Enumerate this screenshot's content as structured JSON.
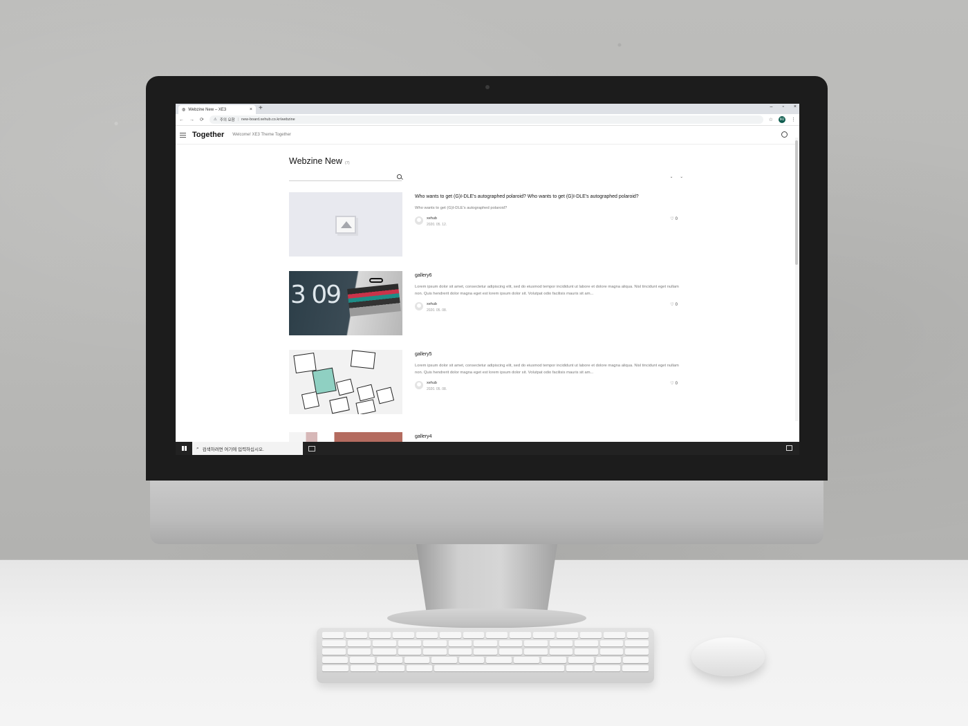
{
  "browser": {
    "tab_title": "Webzine New – XE3",
    "tab_close": "×",
    "new_tab": "+",
    "window_controls": [
      "–",
      "▫",
      "×"
    ],
    "nav_buttons": [
      "←",
      "→",
      "⟳"
    ],
    "security_label": "주의 요함",
    "url": "new-board.xehub.co.kr/webzine",
    "profile_initials": "MJ"
  },
  "site": {
    "logo": "Together",
    "tagline": "Welcome! XE3 Theme Together"
  },
  "board": {
    "title": "Webzine New",
    "count": "(7)",
    "search_placeholder": "",
    "sort_a": "",
    "sort_b": ""
  },
  "posts": [
    {
      "title": "Who wants to get (G)I-DLE's autographed polaroid? Who wants to get (G)I-DLE's autographed polaroid?",
      "excerpt": "Who wants to get (G)I-DLE's autographed polaroid?",
      "author": "xehub",
      "stats": "2020. 05. 12.",
      "likes": "0"
    },
    {
      "title": "gallery6",
      "excerpt": "Lorem ipsum dolor sit amet, consectetur adipiscing elit, sed do eiusmod tempor incididunt ut labore et dolore magna aliqua. Nisl tincidunt eget nullam non. Quis hendrerit dolor magna eget est lorem ipsum dolor sit. Volutpat odio facilisis mauris sit am...",
      "author": "xehub",
      "stats": "2020. 05. 08.",
      "likes": "0"
    },
    {
      "title": "gallery5",
      "excerpt": "Lorem ipsum dolor sit amet, consectetur adipiscing elit, sed do eiusmod tempor incididunt ut labore et dolore magna aliqua. Nisl tincidunt eget nullam non. Quis hendrerit dolor magna eget est lorem ipsum dolor sit. Volutpat odio facilisis mauris sit am...",
      "author": "xehub",
      "stats": "2020. 05. 08.",
      "likes": "0"
    }
  ],
  "partial_post": {
    "title": "gallery4"
  },
  "taskbar": {
    "search_placeholder": "검색하려면 여기에 입력하십시오."
  },
  "thumb_clock_text": "3 09"
}
